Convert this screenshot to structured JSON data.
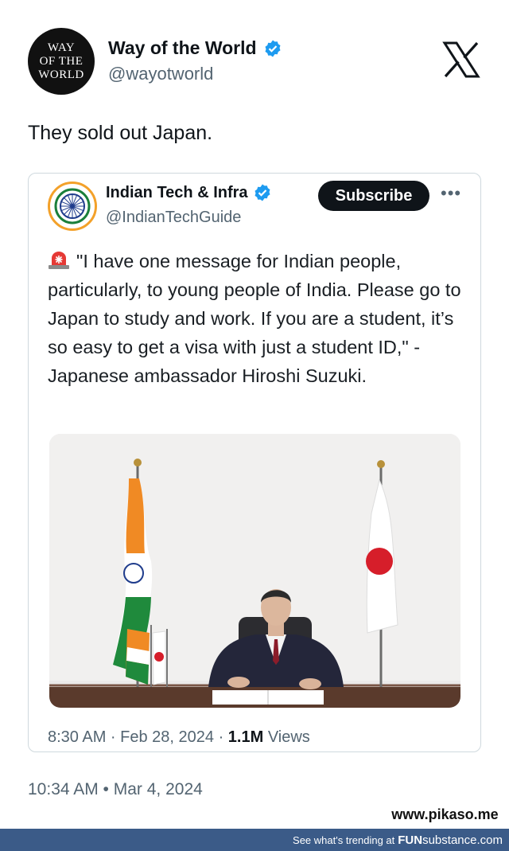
{
  "author": {
    "logo_lines": [
      "WAY",
      "OF THE",
      "WORLD"
    ],
    "name": "Way of the World",
    "handle": "@wayotworld",
    "verified_icon": "verified-badge-icon"
  },
  "platform_icon": "x-logo-icon",
  "tweet": {
    "text": "They sold out Japan.",
    "timestamp": "10:34 AM • Mar 4, 2024"
  },
  "quoted": {
    "name": "Indian Tech & Infra",
    "handle": "@IndianTechGuide",
    "subscribe_label": "Subscribe",
    "more_label": "•••",
    "text": "\"I have one message for Indian people, particularly, to young people of India. Please go to Japan to study and work. If you are a student, it’s so easy to get a visa with just a student ID,\" - Japanese ambassador Hiroshi Suzuki.",
    "time": "8:30 AM · Feb 28, 2024 · ",
    "views_count": "1.1M",
    "views_label": " Views",
    "colors": {
      "accent": "#1d9bf0",
      "saffron": "#f3a12a"
    }
  },
  "watermark": "www.pikaso.me",
  "footer": {
    "text": "See what's trending at",
    "brand_bold": "FUN",
    "brand_rest": "substance",
    "brand_suffix": ".com"
  }
}
